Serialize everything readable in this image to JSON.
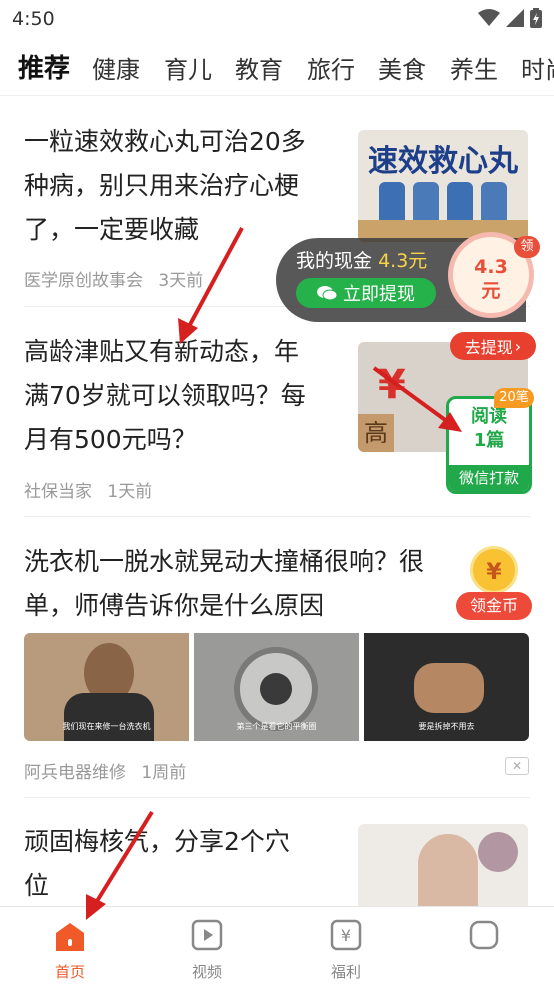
{
  "status": {
    "time": "4:50"
  },
  "tabs": [
    {
      "label": "推荐",
      "active": true
    },
    {
      "label": "健康",
      "active": false
    },
    {
      "label": "育儿",
      "active": false
    },
    {
      "label": "教育",
      "active": false
    },
    {
      "label": "旅行",
      "active": false
    },
    {
      "label": "美食",
      "active": false
    },
    {
      "label": "养生",
      "active": false
    },
    {
      "label": "时尚",
      "active": false
    }
  ],
  "articles": [
    {
      "title_lines": [
        "一粒速效救心丸可治20多",
        "种病，别只用来治疗心梗",
        "了，一定要收藏"
      ],
      "source": "医学原创故事会",
      "time": "3天前",
      "thumb_text": "速效救心丸"
    },
    {
      "title_lines": [
        "高龄津贴又有新动态，年",
        "满70岁就可以领取吗？每",
        "月有500元吗？"
      ],
      "source": "社保当家",
      "time": "1天前",
      "thumb_text": "高龄"
    },
    {
      "title_lines": [
        "洗衣机一脱水就晃动大撞桶很响？很",
        "单，师傅告诉你是什么原因"
      ],
      "source": "阿兵电器维修",
      "time": "1周前",
      "captions": [
        "我们现在来修一台洗衣机",
        "第三个是看它的平衡圈",
        "要是拆掉不用去"
      ]
    },
    {
      "title_lines": [
        "顽固梅核气，分享2个穴",
        "位"
      ]
    }
  ],
  "cash_widget": {
    "label": "我的现金",
    "amount": "4.3元",
    "withdraw_button": "立即提现",
    "circle_line1": "4.3",
    "circle_line2": "元",
    "badge": "领"
  },
  "read_widget": {
    "go_withdraw": "去提现",
    "badge": "20笔",
    "line1": "阅读",
    "line2": "1篇",
    "bottom": "微信打款"
  },
  "coin_widget": {
    "symbol": "¥",
    "label": "领金币"
  },
  "close_label": "✕",
  "bottom_nav": [
    {
      "label": "首页",
      "icon": "home-icon",
      "active": true
    },
    {
      "label": "视频",
      "icon": "video-icon",
      "active": false
    },
    {
      "label": "福利",
      "icon": "welfare-icon",
      "active": false
    },
    {
      "label": "",
      "icon": "profile-icon",
      "active": false
    }
  ],
  "colors": {
    "accent": "#f05a28",
    "green": "#21a84a",
    "red": "#e8402e",
    "arrow": "#d62020"
  }
}
